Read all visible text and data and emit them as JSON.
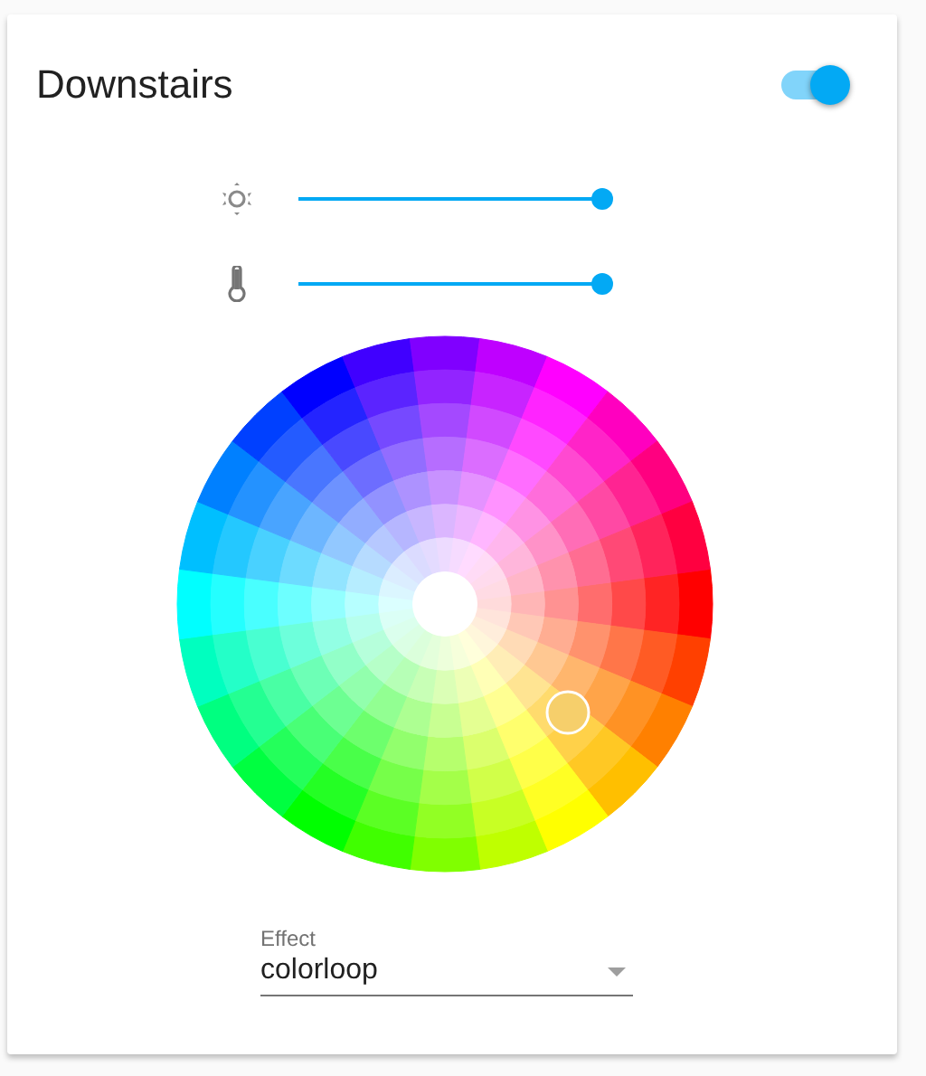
{
  "card": {
    "title": "Downstairs",
    "on": true
  },
  "sliders": [
    {
      "kind": "brightness",
      "level": 1
    },
    {
      "kind": "temperature",
      "level": 1
    }
  ],
  "effect": {
    "label": "Effect",
    "value": "colorloop"
  }
}
